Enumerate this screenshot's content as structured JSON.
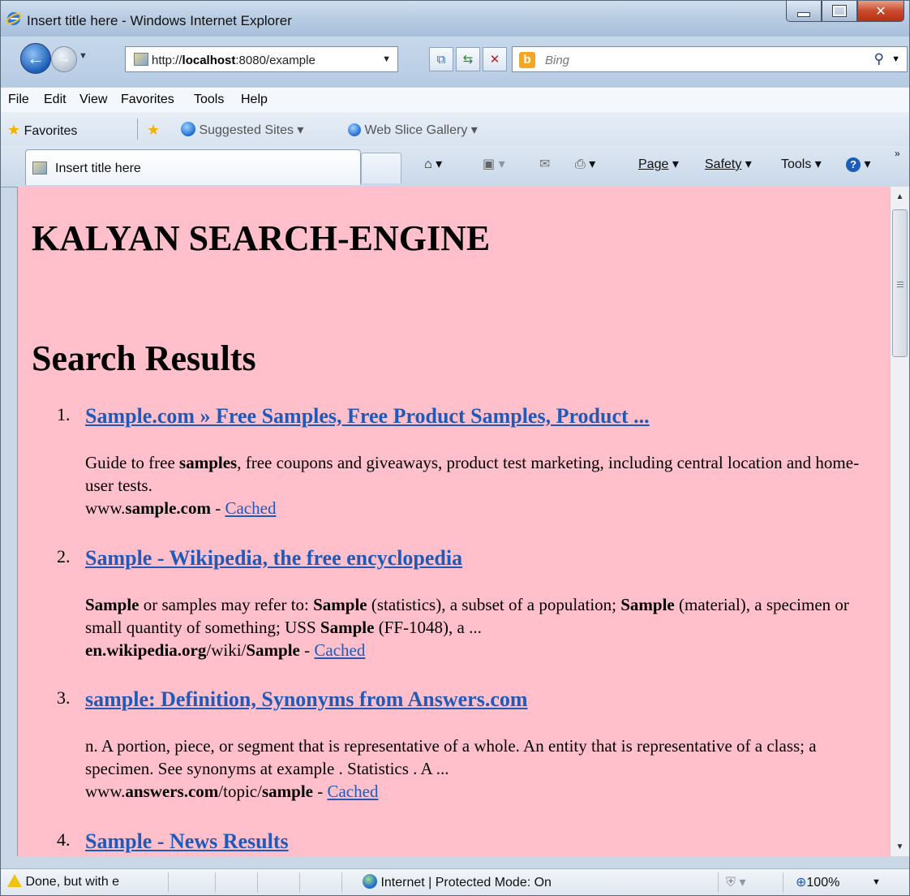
{
  "window": {
    "title": "Insert title here - Windows Internet Explorer"
  },
  "nav": {
    "url_prefix": "http://",
    "url_host": "localhost",
    "url_rest": ":8080/example",
    "search_placeholder": "Bing"
  },
  "menu": [
    "File",
    "Edit",
    "View",
    "Favorites",
    "Tools",
    "Help"
  ],
  "favorites": {
    "label": "Favorites",
    "suggested": "Suggested Sites ▾",
    "webslice": "Web Slice Gallery ▾"
  },
  "tab": {
    "label": "Insert title here"
  },
  "commands": {
    "page": "Page",
    "safety": "Safety",
    "tools": "Tools"
  },
  "page": {
    "heading": "KALYAN SEARCH-ENGINE",
    "subheading": "Search Results",
    "results": [
      {
        "num": "1.",
        "title": "Sample.com » Free Samples, Free Product Samples, Product ...",
        "url_pre": "www.",
        "url_bold": "sample.com",
        "url_post": "",
        "cached": "Cached"
      },
      {
        "num": "2.",
        "title": "Sample - Wikipedia, the free encyclopedia",
        "url_pre": "",
        "url_bold": "en.wikipedia.org",
        "url_post": "/wiki/",
        "url_bold2": "Sample",
        "cached": "Cached"
      },
      {
        "num": "3.",
        "title": "sample: Definition, Synonyms from Answers.com",
        "url_pre": "www.",
        "url_bold": "answers.com",
        "url_post": "/topic/",
        "url_bold2": "sample",
        "cached": "Cached"
      },
      {
        "num": "4.",
        "title": "Sample - News Results"
      }
    ],
    "snip1_a": "Guide to free ",
    "snip1_b": "samples",
    "snip1_c": ", free coupons and giveaways, product test marketing, including central location and home-user tests.",
    "snip2_b1": "Sample",
    "snip2_a": " or samples may refer to: ",
    "snip2_b2": "Sample",
    "snip2_c": " (statistics), a subset of a population; ",
    "snip2_b3": "Sample",
    "snip2_d": " (material), a specimen or small quantity of something; USS ",
    "snip2_b4": "Sample",
    "snip2_e": " (FF-1048), a ...",
    "snip3": "n. A portion, piece, or segment that is representative of a whole. An entity that is representative of a class; a specimen. See synonyms at example . Statistics . A ...",
    "sep": " - "
  },
  "status": {
    "text": "Done, but with e",
    "zone": "Internet | Protected Mode: On",
    "zoom": "100%"
  },
  "colors": {
    "page_bg": "#ffc0cb",
    "link": "#1f5ab8"
  }
}
